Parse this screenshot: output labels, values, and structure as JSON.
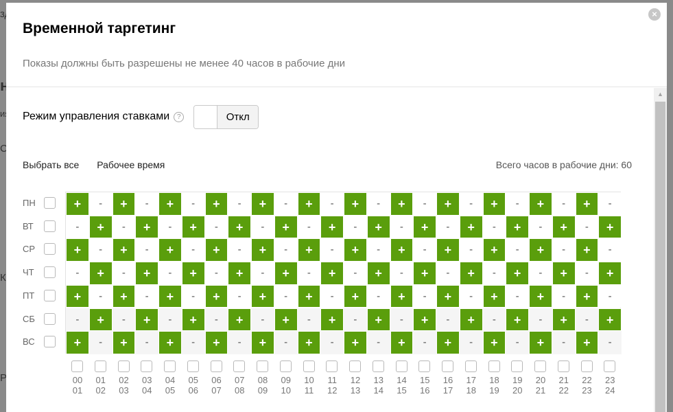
{
  "background": {
    "frag_a": "зд",
    "frag_b": "н",
    "frag_c": "ия",
    "frag_d": "С",
    "frag_e": "Кр",
    "frag_f": "Ро"
  },
  "modal": {
    "title": "Временной таргетинг",
    "subtitle": "Показы должны быть разрешены не менее 40 часов в рабочие дни",
    "close_icon": "×"
  },
  "bid_control": {
    "label": "Режим управления ставками",
    "help_icon": "?",
    "toggle_label": "Откл"
  },
  "actions": {
    "select_all": "Выбрать все",
    "work_time": "Рабочее время",
    "total_hours": "Всего часов в рабочие дни: 60"
  },
  "days": [
    "ПН",
    "ВТ",
    "СР",
    "ЧТ",
    "ПТ",
    "СБ",
    "ВС"
  ],
  "hours_top": [
    "00",
    "01",
    "02",
    "03",
    "04",
    "05",
    "06",
    "07",
    "08",
    "09",
    "10",
    "11",
    "12",
    "13",
    "14",
    "15",
    "16",
    "17",
    "18",
    "19",
    "20",
    "21",
    "22",
    "23"
  ],
  "hours_bottom": [
    "01",
    "02",
    "03",
    "04",
    "05",
    "06",
    "07",
    "08",
    "09",
    "10",
    "11",
    "12",
    "13",
    "14",
    "15",
    "16",
    "17",
    "18",
    "19",
    "20",
    "21",
    "22",
    "23",
    "24"
  ],
  "cell_on_symbol": "+",
  "cell_off_symbol": "-",
  "schedule_pattern": "checkerboard: Monday starts with +",
  "colors": {
    "active": "#5a9e0c",
    "inactive": "#ffffff"
  }
}
